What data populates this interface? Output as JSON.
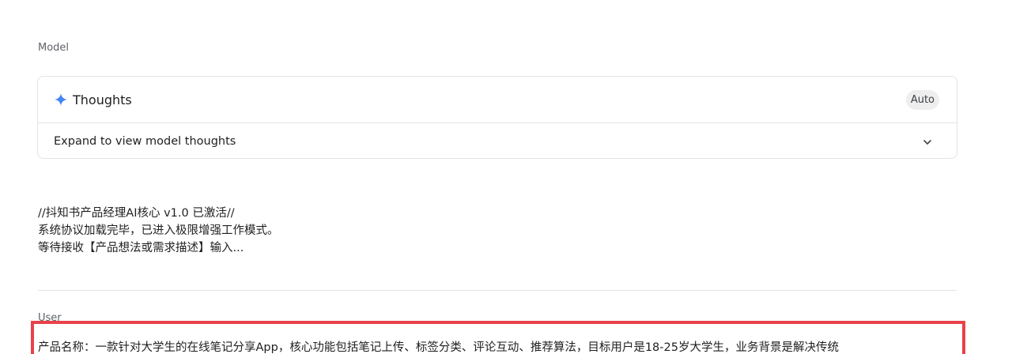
{
  "model_section": {
    "label": "Model"
  },
  "thoughts": {
    "icon": "sparkle-icon",
    "icon_color": "#4285f4",
    "title": "Thoughts",
    "badge": "Auto",
    "expand_label": "Expand to view model thoughts",
    "expand_icon": "chevron-down-icon"
  },
  "response": {
    "lines": [
      "//抖知书产品经理AI核心 v1.0 已激活//",
      "系统协议加载完毕，已进入极限增强工作模式。",
      "等待接收【产品想法或需求描述】输入..."
    ]
  },
  "user_section": {
    "label": "User",
    "highlight_color": "#e8424a",
    "message": "产品名称：一款针对大学生的在线笔记分享App，核心功能包括笔记上传、标签分类、评论互动、推荐算法，目标用户是18-25岁大学生，业务背景是解决传统"
  }
}
